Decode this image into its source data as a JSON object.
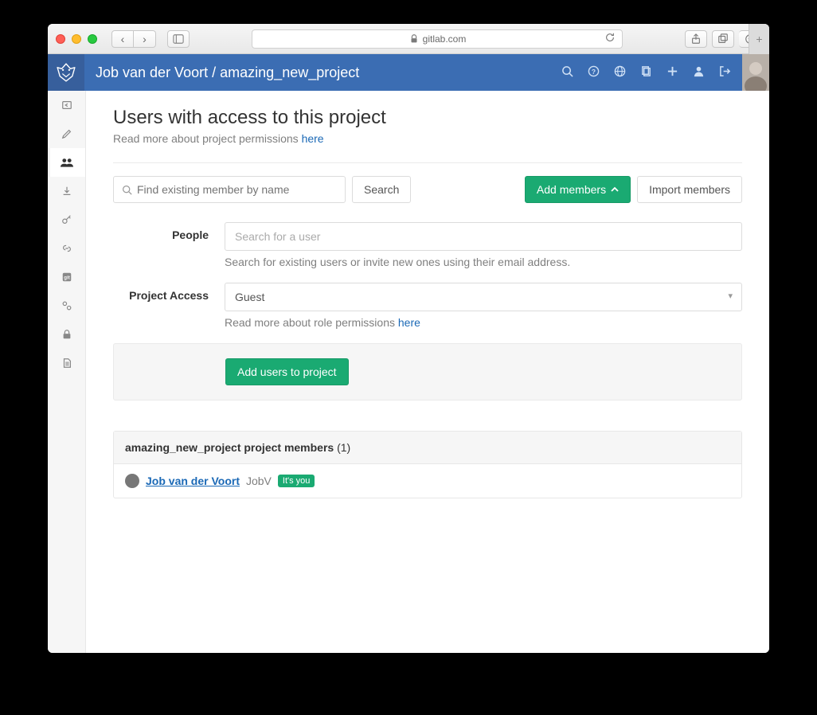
{
  "browser": {
    "domain": "gitlab.com"
  },
  "breadcrumb": {
    "owner": "Job van der Voort",
    "separator": "/",
    "project": "amazing_new_project"
  },
  "page": {
    "title": "Users with access to this project",
    "subtitle_prefix": "Read more about project permissions ",
    "subtitle_link": "here"
  },
  "search": {
    "placeholder": "Find existing member by name",
    "button": "Search"
  },
  "actions": {
    "add_members": "Add members",
    "import_members": "Import members"
  },
  "form": {
    "people_label": "People",
    "people_placeholder": "Search for a user",
    "people_help": "Search for existing users or invite new ones using their email address.",
    "access_label": "Project Access",
    "access_value": "Guest",
    "access_help_prefix": "Read more about role permissions ",
    "access_help_link": "here",
    "submit": "Add users to project"
  },
  "members_panel": {
    "title_prefix": "amazing_new_project project members",
    "count": "(1)",
    "member_name": "Job van der Voort",
    "member_handle": "JobV",
    "badge": "It's you"
  }
}
